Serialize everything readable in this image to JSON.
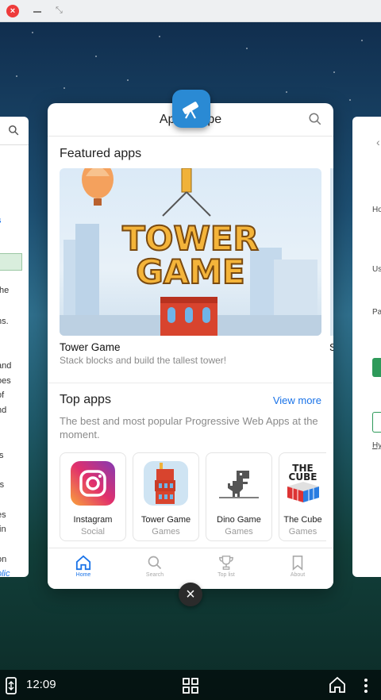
{
  "window": {
    "close_label": "×",
    "minimize_label": "",
    "maximize_label": "⤡"
  },
  "background_cards": {
    "left_fragments": [
      "s",
      "the",
      "ns.",
      "-",
      "and",
      "oes",
      "of",
      "nd",
      "ts",
      "rs",
      "es",
      "tin",
      "on",
      "olic"
    ],
    "right_fragments": [
      "Ho",
      "Us",
      "Pa",
      "Hy"
    ]
  },
  "app": {
    "title": "App Scope",
    "featured_title": "Featured apps",
    "featured": {
      "banner_text_line1": "TOWER",
      "banner_text_line2": "GAME",
      "name": "Tower Game",
      "subtitle": "Stack blocks and build the tallest tower!",
      "next_peek": "S"
    },
    "top_apps_title": "Top apps",
    "view_more_label": "View more",
    "top_apps_description": "The best and most popular Progressive Web Apps at the moment.",
    "top_apps": [
      {
        "name": "Instagram",
        "category": "Social",
        "icon": "instagram-icon"
      },
      {
        "name": "Tower Game",
        "category": "Games",
        "icon": "tower-game-icon"
      },
      {
        "name": "Dino Game",
        "category": "Games",
        "icon": "dino-icon"
      },
      {
        "name": "The Cube",
        "category": "Games",
        "icon": "cube-icon"
      }
    ],
    "cube_icon_text": "THE CUBE",
    "nav": [
      {
        "label": "Home",
        "icon": "home-icon",
        "active": true
      },
      {
        "label": "Search",
        "icon": "search-icon",
        "active": false
      },
      {
        "label": "Top list",
        "icon": "trophy-icon",
        "active": false
      },
      {
        "label": "About",
        "icon": "bookmark-icon",
        "active": false
      }
    ]
  },
  "close_card_label": "×",
  "shelf": {
    "time": "12:09"
  },
  "colors": {
    "accent": "#1a73e8",
    "close_red": "#ee3b3b",
    "app_icon_blue": "#2a8ad4"
  }
}
